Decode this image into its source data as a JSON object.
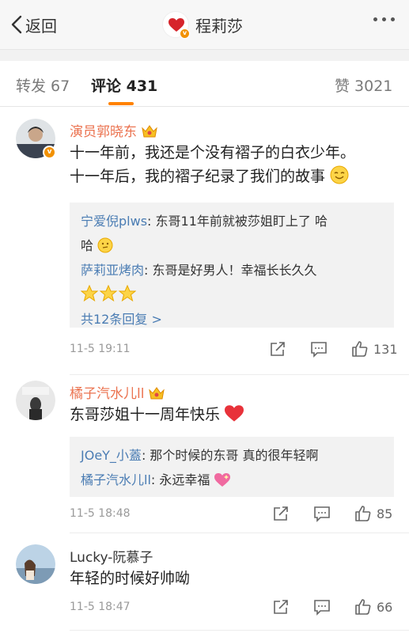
{
  "header": {
    "back_label": "返回",
    "title": "程莉莎"
  },
  "tabs": [
    {
      "label": "转发 67"
    },
    {
      "label": "评论 431"
    },
    {
      "label": "赞 3021"
    }
  ],
  "colors": {
    "accent": "#ff8200",
    "name_orange": "#eb7350",
    "link_blue": "#4a7cb3"
  },
  "comments": [
    {
      "name": "演员郭晓东",
      "lines": [
        "十一年前，我还是个没有褶子的白衣少年。",
        "十一年后，我的褶子纪录了我们的故事"
      ],
      "replies": [
        {
          "name": "宁爱倪plws",
          "text_line1": "东哥11年前就被莎姐盯上了 哈",
          "text_line2": "哈"
        },
        {
          "name": "萨莉亚烤肉",
          "text": "东哥是好男人！幸福长长久久"
        }
      ],
      "more_replies": "共12条回复 >",
      "time": "11-5 19:11",
      "likes": "131"
    },
    {
      "name": "橘子汽水儿ll",
      "text": "东哥莎姐十一周年快乐",
      "replies": [
        {
          "name": "JOeY_小蓋",
          "text": "那个时候的东哥 真的很年轻啊"
        },
        {
          "name": "橘子汽水儿ll",
          "text": "永远幸福"
        }
      ],
      "time": "11-5 18:48",
      "likes": "85"
    },
    {
      "name": "Lucky-阮慕子",
      "text": "年轻的时候好帅呦",
      "time": "11-5 18:47",
      "likes": "66"
    }
  ]
}
